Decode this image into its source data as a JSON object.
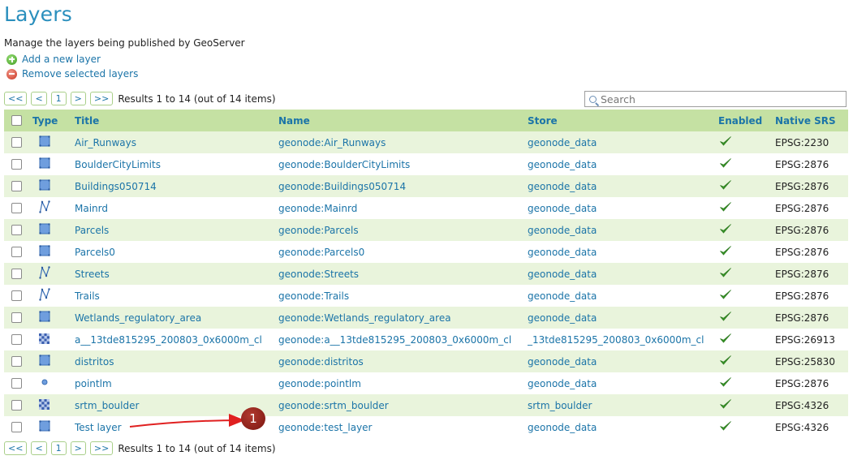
{
  "page": {
    "title": "Layers",
    "description": "Manage the layers being published by GeoServer"
  },
  "actions": {
    "add_label": "Add a new layer",
    "remove_label": "Remove selected layers"
  },
  "pager": {
    "first": "<<",
    "prev": "<",
    "page": "1",
    "next": ">",
    "last": ">>",
    "results": "Results 1 to 14 (out of 14 items)"
  },
  "search": {
    "placeholder": "Search"
  },
  "columns": [
    "Type",
    "Title",
    "Name",
    "Store",
    "Enabled",
    "Native SRS"
  ],
  "rows": [
    {
      "type": "polygon",
      "title": "Air_Runways",
      "name": "geonode:Air_Runways",
      "store": "geonode_data",
      "enabled": true,
      "srs": "EPSG:2230"
    },
    {
      "type": "polygon",
      "title": "BoulderCityLimits",
      "name": "geonode:BoulderCityLimits",
      "store": "geonode_data",
      "enabled": true,
      "srs": "EPSG:2876"
    },
    {
      "type": "polygon",
      "title": "Buildings050714",
      "name": "geonode:Buildings050714",
      "store": "geonode_data",
      "enabled": true,
      "srs": "EPSG:2876"
    },
    {
      "type": "line",
      "title": "Mainrd",
      "name": "geonode:Mainrd",
      "store": "geonode_data",
      "enabled": true,
      "srs": "EPSG:2876"
    },
    {
      "type": "polygon",
      "title": "Parcels",
      "name": "geonode:Parcels",
      "store": "geonode_data",
      "enabled": true,
      "srs": "EPSG:2876"
    },
    {
      "type": "polygon",
      "title": "Parcels0",
      "name": "geonode:Parcels0",
      "store": "geonode_data",
      "enabled": true,
      "srs": "EPSG:2876"
    },
    {
      "type": "line",
      "title": "Streets",
      "name": "geonode:Streets",
      "store": "geonode_data",
      "enabled": true,
      "srs": "EPSG:2876"
    },
    {
      "type": "line",
      "title": "Trails",
      "name": "geonode:Trails",
      "store": "geonode_data",
      "enabled": true,
      "srs": "EPSG:2876"
    },
    {
      "type": "polygon",
      "title": "Wetlands_regulatory_area",
      "name": "geonode:Wetlands_regulatory_area",
      "store": "geonode_data",
      "enabled": true,
      "srs": "EPSG:2876"
    },
    {
      "type": "raster",
      "title": "a__13tde815295_200803_0x6000m_cl",
      "name": "geonode:a__13tde815295_200803_0x6000m_cl",
      "store": "_13tde815295_200803_0x6000m_cl",
      "enabled": true,
      "srs": "EPSG:26913"
    },
    {
      "type": "polygon",
      "title": "distritos",
      "name": "geonode:distritos",
      "store": "geonode_data",
      "enabled": true,
      "srs": "EPSG:25830"
    },
    {
      "type": "point",
      "title": "pointlm",
      "name": "geonode:pointlm",
      "store": "geonode_data",
      "enabled": true,
      "srs": "EPSG:2876"
    },
    {
      "type": "raster",
      "title": "srtm_boulder",
      "name": "geonode:srtm_boulder",
      "store": "srtm_boulder",
      "enabled": true,
      "srs": "EPSG:4326"
    },
    {
      "type": "polygon",
      "title": "Test layer",
      "name": "geonode:test_layer",
      "store": "geonode_data",
      "enabled": true,
      "srs": "EPSG:4326"
    }
  ],
  "annotation": {
    "label": "1",
    "color": "#8b1d15"
  },
  "colors": {
    "accent": "#2a8fbd",
    "link": "#1b74a8",
    "header_bg": "#c5e1a3",
    "row_alt_bg": "#e9f4dc",
    "enabled_check": "#3a9a2a"
  }
}
